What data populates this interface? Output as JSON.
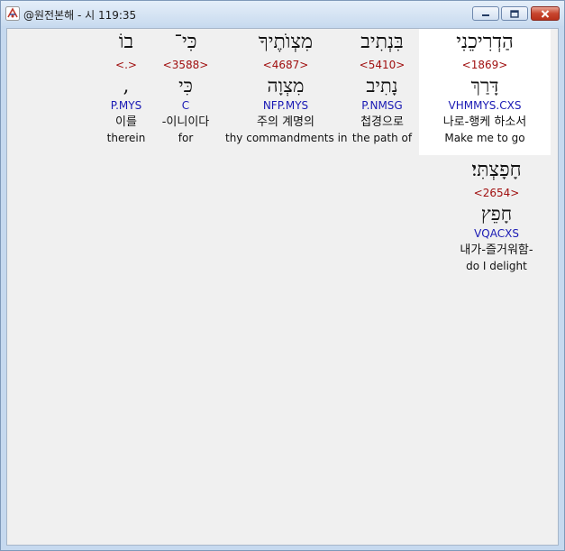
{
  "window": {
    "title": "@원전본해 - 시 119:35"
  },
  "words": [
    {
      "hebrew": "הַדְרִיכֵנִי",
      "strong": "<1869>",
      "lemma": "דָּרַךְ",
      "morph": "VHMMYS.CXS",
      "korean": "나로-행케 하소서",
      "english": "Make me to go"
    },
    {
      "hebrew": "בִּנְתִיב",
      "strong": "<5410>",
      "lemma": "נָתִיב",
      "morph": "P.NMSG",
      "korean": "첩경으로",
      "english": "the path of"
    },
    {
      "hebrew": "מִצְוֺתֶיךָ",
      "strong": "<4687>",
      "lemma": "מִצְוָה",
      "morph": "NFP.MYS",
      "korean": "주의 계명의",
      "english": "thy commandments in"
    },
    {
      "hebrew": "כִּי־",
      "strong": "<3588>",
      "lemma": "כִּי",
      "morph": "C",
      "korean": "-이니이다",
      "english": "for"
    },
    {
      "hebrew": "בוֹ",
      "strong": "<.>",
      "lemma": ",",
      "morph": "P.MYS",
      "korean": "이를",
      "english": "therein"
    },
    {
      "hebrew": "חָפָצְתִּי׃",
      "strong": "<2654>",
      "lemma": "חָפֵץ",
      "morph": "VQACXS",
      "korean": "내가-즐거워함-",
      "english": "do I delight"
    }
  ]
}
